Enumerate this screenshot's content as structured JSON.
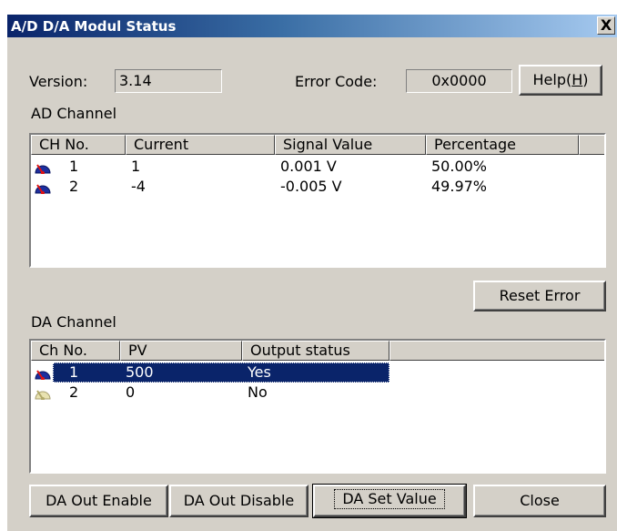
{
  "window": {
    "title": "A/D D/A Modul Status",
    "close_glyph": "X"
  },
  "version": {
    "label": "Version:",
    "value": "3.14"
  },
  "error": {
    "label": "Error Code:",
    "value": "0x0000"
  },
  "help_button": {
    "prefix": "Help(",
    "accel": "H",
    "suffix": ")"
  },
  "ad_channel": {
    "label": "AD Channel",
    "columns": [
      "CH No.",
      "Current",
      "Signal Value",
      "Percentage",
      ""
    ],
    "rows": [
      {
        "icon": "active-channel-icon",
        "ch": "1",
        "current": "1",
        "signal": "0.001 V",
        "percentage": "50.00%"
      },
      {
        "icon": "active-channel-icon",
        "ch": "2",
        "current": "-4",
        "signal": "-0.005 V",
        "percentage": "49.97%"
      }
    ]
  },
  "reset_error_label": "Reset Error",
  "da_channel": {
    "label": "DA Channel",
    "columns": [
      "Ch No.",
      "PV",
      "Output status",
      ""
    ],
    "rows": [
      {
        "icon": "active-channel-icon",
        "ch": "1",
        "pv": "500",
        "status": "Yes",
        "selected": true
      },
      {
        "icon": "inactive-channel-icon",
        "ch": "2",
        "pv": "0",
        "status": "No",
        "selected": false
      }
    ]
  },
  "buttons": {
    "da_out_enable": "DA Out Enable",
    "da_out_disable": "DA Out Disable",
    "da_set_value": "DA Set Value",
    "close": "Close"
  },
  "colors": {
    "title_start": "#0a246a",
    "title_end": "#a6caf0",
    "face": "#d4d0c8",
    "selection": "#0a246a"
  }
}
